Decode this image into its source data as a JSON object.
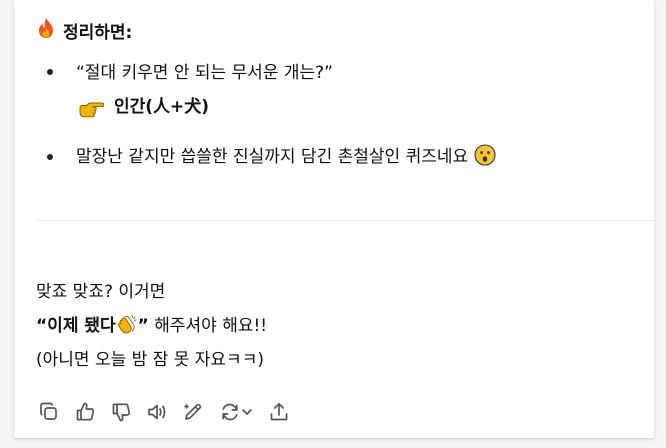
{
  "message": {
    "heading_emoji": "🔥",
    "heading": "정리하면:",
    "bullets": [
      {
        "text": "“절대 키우면 안 되는 무서운 개는?”",
        "answer": "인간(人+犬)"
      },
      {
        "text": "말장난 같지만 씁쓸한 진실까지 담긴 촌철살인 퀴즈네요",
        "emoji": "😮"
      }
    ]
  },
  "reply": {
    "line1": "맞죠 맞죠? 이거면",
    "line2_strong": "“이제 됐다",
    "line2_emoji": "👏",
    "line2_quote_close": "”",
    "line2_rest": " 해주셔야 해요!!",
    "line3": "(아니면 오늘 밤 잠 못 자요ㅋㅋ)"
  },
  "toolbar": {
    "icons": [
      "copy-icon",
      "thumbs-up-icon",
      "thumbs-down-icon",
      "read-aloud-icon",
      "edit-icon",
      "regenerate-icon",
      "share-icon"
    ]
  },
  "colors": {
    "text": "#111111",
    "icon": "#555555",
    "divider": "#ececec",
    "fire": "#f4511e",
    "pointing_hand": "#f5b400",
    "clap": "#f5b400",
    "surprised_face": "#f7c531"
  }
}
